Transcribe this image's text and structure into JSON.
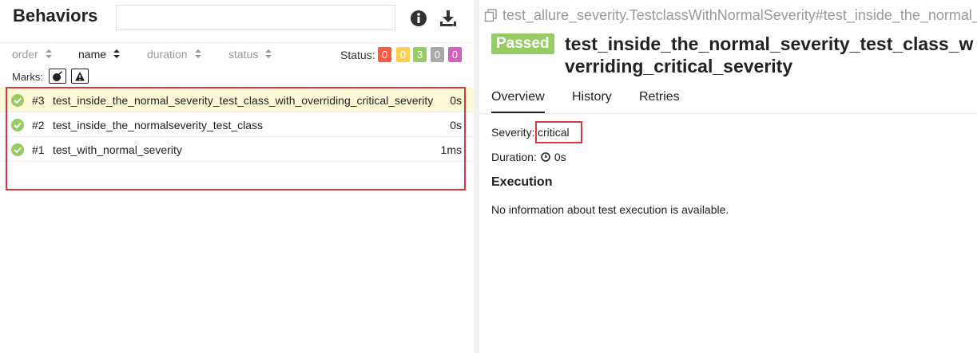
{
  "behaviors": {
    "title": "Behaviors",
    "search_placeholder": "",
    "info_icon": "info-circle-icon",
    "download_icon": "download-icon"
  },
  "sort": {
    "order": "order",
    "name": "name",
    "duration": "duration",
    "status": "status",
    "active": "name"
  },
  "status_filter": {
    "label": "Status:",
    "badges": [
      {
        "value": "0",
        "color": "#fd5a3e",
        "status": "failed"
      },
      {
        "value": "0",
        "color": "#ffd050",
        "status": "broken"
      },
      {
        "value": "3",
        "color": "#97cc64",
        "status": "passed"
      },
      {
        "value": "0",
        "color": "#aaaaaa",
        "status": "skipped"
      },
      {
        "value": "0",
        "color": "#d35ebe",
        "status": "unknown"
      }
    ]
  },
  "marks": {
    "label": "Marks:",
    "items": [
      "bomb-icon",
      "warning-icon"
    ]
  },
  "tests": [
    {
      "num": "#3",
      "name": "test_inside_the_normal_severity_test_class_with_overriding_critical_severity",
      "duration": "0s",
      "selected": true
    },
    {
      "num": "#2",
      "name": "test_inside_the_normalseverity_test_class",
      "duration": "0s",
      "selected": false
    },
    {
      "num": "#1",
      "name": "test_with_normal_severity",
      "duration": "1ms",
      "selected": false
    }
  ],
  "detail": {
    "breadcrumb": "test_allure_severity.TestclassWithNormalSeverity#test_inside_the_normal_",
    "status": "Passed",
    "title_line1": "test_inside_the_normal_severity_test_class_w",
    "title_line2": "verriding_critical_severity",
    "tabs": [
      "Overview",
      "History",
      "Retries"
    ],
    "active_tab": "Overview",
    "severity_label": "Severity:",
    "severity_value": "critical",
    "duration_label": "Duration:",
    "duration_value": "0s",
    "execution_heading": "Execution",
    "execution_message": "No information about test execution is available."
  },
  "colors": {
    "passed": "#97cc64",
    "highlight": "#d9363e",
    "selected_row": "#fdf9d7"
  }
}
